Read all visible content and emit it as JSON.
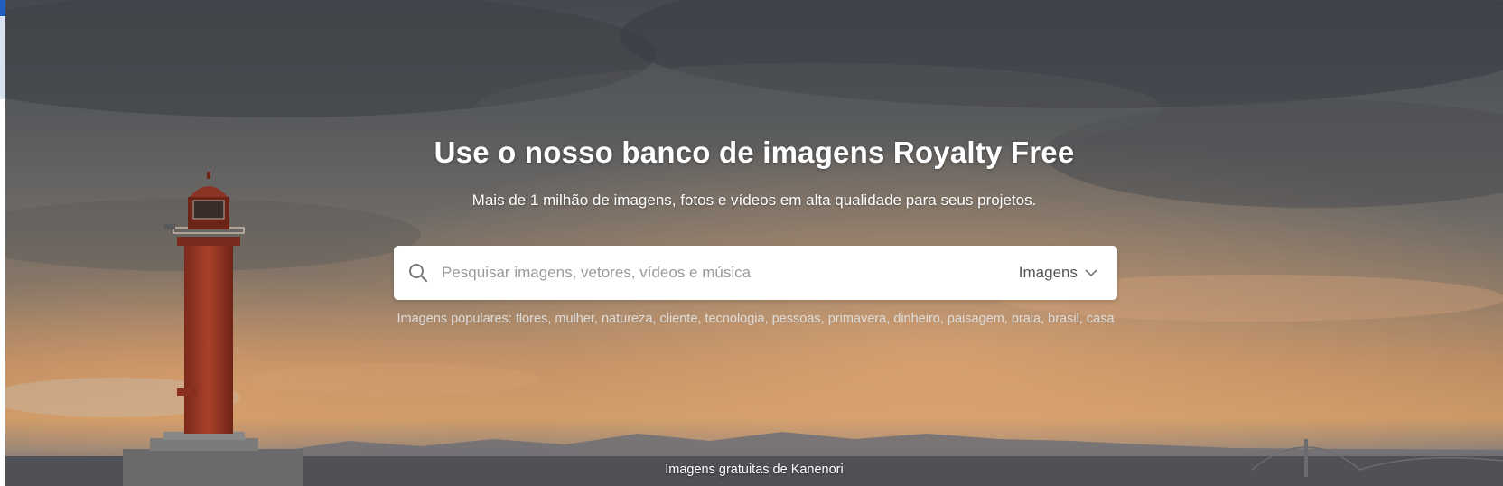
{
  "hero": {
    "title": "Use o nosso banco de imagens Royalty Free",
    "subtitle": "Mais de 1 milhão de imagens, fotos e vídeos em alta qualidade para seus projetos."
  },
  "search": {
    "placeholder": "Pesquisar imagens, vetores, vídeos e música",
    "value": "",
    "type_selected": "Imagens",
    "icon": "search-icon",
    "dropdown_icon": "chevron-down-icon"
  },
  "popular": {
    "label": "Imagens populares:",
    "items": [
      "flores",
      "mulher",
      "natureza",
      "cliente",
      "tecnologia",
      "pessoas",
      "primavera",
      "dinheiro",
      "paisagem",
      "praia",
      "brasil",
      "casa"
    ]
  },
  "credit": {
    "text": "Imagens gratuitas de Kanenori"
  },
  "colors": {
    "sky_top": "#4a4f55",
    "sky_mid": "#6b6965",
    "sunset": "#d4985c",
    "lighthouse_red": "#a33a26"
  }
}
